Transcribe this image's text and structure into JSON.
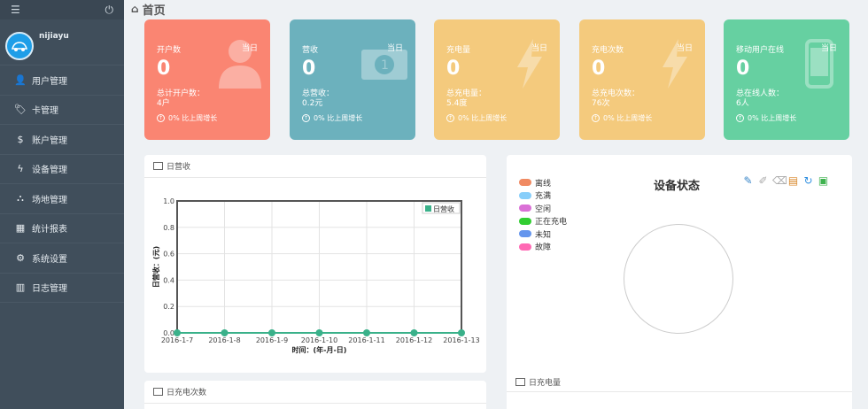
{
  "sidebar": {
    "menu_icon": "hamburger-icon",
    "power_icon": "power-icon",
    "username": "nijiayu",
    "items": [
      {
        "label": "用户管理",
        "icon": "user-icon"
      },
      {
        "label": "卡管理",
        "icon": "tag-icon"
      },
      {
        "label": "账户管理",
        "icon": "dollar-icon"
      },
      {
        "label": "设备管理",
        "icon": "bolt-icon"
      },
      {
        "label": "场地管理",
        "icon": "sitemap-icon"
      },
      {
        "label": "统计报表",
        "icon": "table-icon"
      },
      {
        "label": "系统设置",
        "icon": "gear-icon"
      },
      {
        "label": "日志管理",
        "icon": "book-icon"
      }
    ]
  },
  "header": {
    "title": "首页"
  },
  "cards": [
    {
      "title": "开户数",
      "tag": "当日",
      "value": "0",
      "sub1": "总计开户数：",
      "sub2": "4户",
      "growth": "0% 比上周增长",
      "color": "#fa8572"
    },
    {
      "title": "营收",
      "tag": "当日",
      "value": "0",
      "sub1": "总营收：",
      "sub2": "0.2元",
      "growth": "0% 比上周增长",
      "color": "#6cb1bd"
    },
    {
      "title": "充电量",
      "tag": "当日",
      "value": "0",
      "sub1": "总充电量：",
      "sub2": "5.4度",
      "growth": "0% 比上周增长",
      "color": "#f4ca7d"
    },
    {
      "title": "充电次数",
      "tag": "当日",
      "value": "0",
      "sub1": "总充电次数：",
      "sub2": "76次",
      "growth": "0% 比上周增长",
      "color": "#f4ca7d"
    },
    {
      "title": "移动用户在线",
      "tag": "当日",
      "value": "0",
      "sub1": "总在线人数：",
      "sub2": "6人",
      "growth": "0% 比上周增长",
      "color": "#66d0a1"
    }
  ],
  "revenue_panel": {
    "title": "日营收"
  },
  "count_panel": {
    "title": "日充电次数"
  },
  "status_panel": {
    "title": "设备状态",
    "legend": [
      {
        "label": "离线",
        "color": "#f08a62"
      },
      {
        "label": "充满",
        "color": "#87cefa"
      },
      {
        "label": "空闲",
        "color": "#da70d6"
      },
      {
        "label": "正在充电",
        "color": "#32cd32"
      },
      {
        "label": "未知",
        "color": "#6495ed"
      },
      {
        "label": "故障",
        "color": "#ff69b4"
      }
    ],
    "sub_title": "日充电量"
  },
  "chart_data": {
    "type": "line",
    "x": [
      "2016-1-7",
      "2016-1-8",
      "2016-1-9",
      "2016-1-10",
      "2016-1-11",
      "2016-1-12",
      "2016-1-13"
    ],
    "series": [
      {
        "name": "日营收",
        "values": [
          0,
          0,
          0,
          0,
          0,
          0,
          0
        ]
      }
    ],
    "ylabel": "日营收：(元)",
    "xlabel": "时间：(年-月-日)",
    "ylim": [
      0,
      1.0
    ],
    "yticks": [
      "0.0",
      "0.2",
      "0.4",
      "0.6",
      "0.8",
      "1.0"
    ],
    "grid": true,
    "legend_position": "top-right",
    "series_color": "#3ab18a"
  }
}
